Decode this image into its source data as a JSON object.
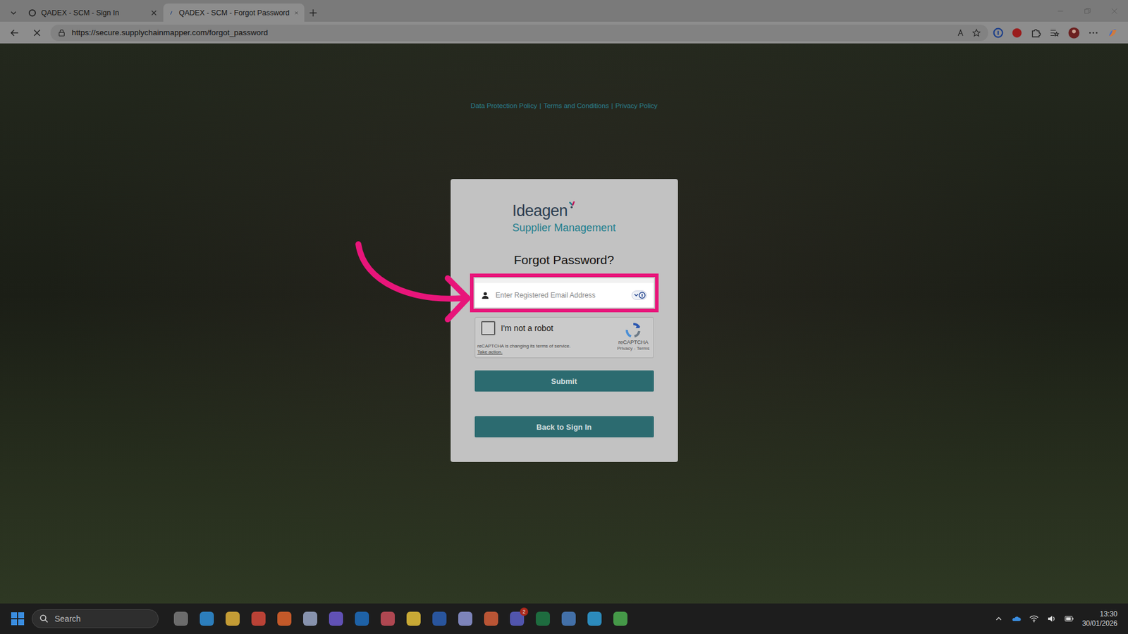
{
  "browser": {
    "tabs": [
      {
        "label": "QADEX - SCM - Sign In",
        "selected": false
      },
      {
        "label": "QADEX - SCM - Forgot Password",
        "selected": true
      }
    ],
    "address": "https://secure.supplychainmapper.com/forgot_password",
    "loading": true
  },
  "page": {
    "links": [
      "Data Protection Policy",
      "Terms and Conditions",
      "Privacy Policy"
    ],
    "link_separator": "|",
    "logo": {
      "name": "Ideagen",
      "product": "Supplier Management"
    },
    "title": "Forgot Password?",
    "email_field": {
      "placeholder": "Enter Registered Email Address",
      "value": "",
      "highlighted": true
    },
    "captcha": {
      "label": "I'm not a robot",
      "checked": false,
      "notice": "reCAPTCHA is changing its terms of service.",
      "notice_link": "Take action.",
      "brand": "reCAPTCHA",
      "links": "Privacy - Terms"
    },
    "buttons": [
      "Submit",
      "Back to Sign In"
    ]
  },
  "taskbar": {
    "search": "Search",
    "apps": [
      {
        "color": "#7a7a7a",
        "badge": ""
      },
      {
        "color": "#2f8fd8",
        "badge": ""
      },
      {
        "color": "#e2b33a",
        "badge": ""
      },
      {
        "color": "#d6493b",
        "badge": ""
      },
      {
        "color": "#e0642b",
        "badge": ""
      },
      {
        "color": "#9aa7c7",
        "badge": ""
      },
      {
        "color": "#6d5bd0",
        "badge": ""
      },
      {
        "color": "#1e6fc0",
        "badge": ""
      },
      {
        "color": "#c94f5a",
        "badge": ""
      },
      {
        "color": "#e6c23a",
        "badge": ""
      },
      {
        "color": "#2b5fb4",
        "badge": ""
      },
      {
        "color": "#8e96d6",
        "badge": ""
      },
      {
        "color": "#d65f3a",
        "badge": ""
      },
      {
        "color": "#5b5fc7",
        "badge": "2"
      },
      {
        "color": "#1e7a45",
        "badge": ""
      },
      {
        "color": "#4a7fc1",
        "badge": ""
      },
      {
        "color": "#2f9fd8",
        "badge": ""
      },
      {
        "color": "#4caf50",
        "badge": ""
      }
    ],
    "time": "13:30",
    "date": "30/01/2026"
  }
}
